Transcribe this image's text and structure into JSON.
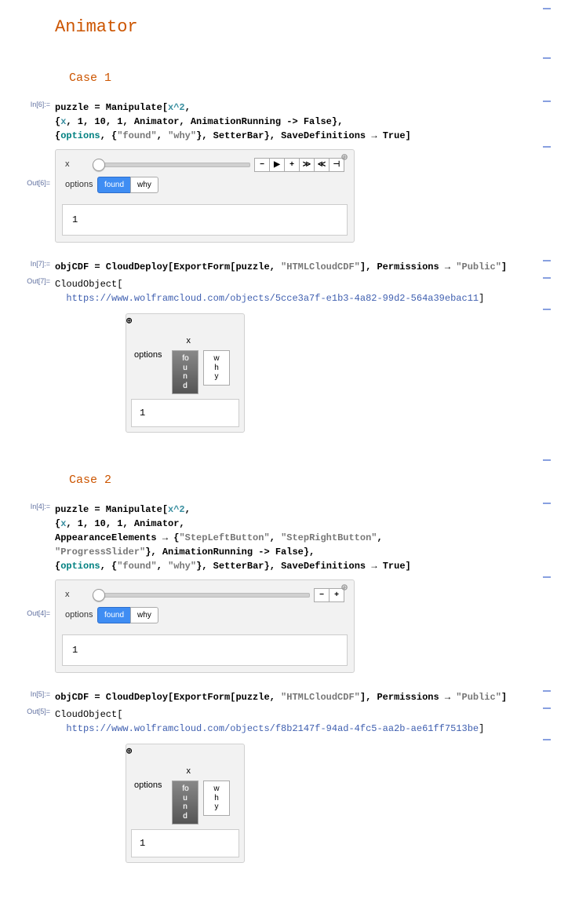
{
  "title": "Animator",
  "case1": {
    "title": "Case 1",
    "in6_label": "In[6]:=",
    "out6_label": "Out[6]=",
    "in7_label": "In[7]:=",
    "out7_label": "Out[7]=",
    "code_line1_a": "puzzle = Manipulate[",
    "code_line1_b": "x^2",
    "code_line1_c": ",",
    "code_line2_a": "  {",
    "code_line2_b": "x",
    "code_line2_c": ", 1, 10, 1, Animator, AnimationRunning -> False},",
    "code_line3_a": "  {",
    "code_line3_b": "options",
    "code_line3_c": ", {",
    "code_line3_d": "\"found\"",
    "code_line3_e": ", ",
    "code_line3_f": "\"why\"",
    "code_line3_g": "}, SetterBar}, SaveDefinitions → True]",
    "x_label": "x",
    "options_label": "options",
    "opt_found": "found",
    "opt_why": "why",
    "output_value": "1",
    "anim_buttons": [
      "−",
      "▶",
      "+",
      "≫",
      "≪",
      "⊣"
    ],
    "deploy_code_a": "objCDF = CloudDeploy[ExportForm[puzzle, ",
    "deploy_code_b": "\"HTMLCloudCDF\"",
    "deploy_code_c": "], Permissions → ",
    "deploy_code_d": "\"Public\"",
    "deploy_code_e": "]",
    "cloudobj_a": "CloudObject[",
    "cloudobj_url": "https://www.wolframcloud.com/objects/5cce3a7f-e1b3-4a82-99d2-564a39ebac11",
    "cloudobj_c": "]",
    "narrow_x": "x",
    "narrow_optlabel": "options",
    "narrow_found": "found",
    "narrow_why": "why",
    "narrow_output": "1"
  },
  "case2": {
    "title": "Case 2",
    "in4_label": "In[4]:=",
    "out4_label": "Out[4]=",
    "in5_label": "In[5]:=",
    "out5_label": "Out[5]=",
    "code_line1_a": "puzzle = Manipulate[",
    "code_line1_b": "x^2",
    "code_line1_c": ",",
    "code_line2_a": "  {",
    "code_line2_b": "x",
    "code_line2_c": ", 1, 10, 1, Animator,",
    "code_line3_a": "    AppearanceElements → {",
    "code_line3_b": "\"StepLeftButton\"",
    "code_line3_c": ", ",
    "code_line3_d": "\"StepRightButton\"",
    "code_line3_e": ",",
    "code_line4_a": "      ",
    "code_line4_b": "\"ProgressSlider\"",
    "code_line4_c": "}, AnimationRunning -> False},",
    "code_line5_a": "  {",
    "code_line5_b": "options",
    "code_line5_c": ", {",
    "code_line5_d": "\"found\"",
    "code_line5_e": ", ",
    "code_line5_f": "\"why\"",
    "code_line5_g": "}, SetterBar}, SaveDefinitions → True]",
    "x_label": "x",
    "options_label": "options",
    "opt_found": "found",
    "opt_why": "why",
    "output_value": "1",
    "step_buttons": [
      "−",
      "+"
    ],
    "deploy_code_a": "objCDF = CloudDeploy[ExportForm[puzzle, ",
    "deploy_code_b": "\"HTMLCloudCDF\"",
    "deploy_code_c": "], Permissions → ",
    "deploy_code_d": "\"Public\"",
    "deploy_code_e": "]",
    "cloudobj_a": "CloudObject[",
    "cloudobj_url": "https://www.wolframcloud.com/objects/f8b2147f-94ad-4fc5-aa2b-ae61ff7513be",
    "cloudobj_c": "]",
    "narrow_x": "x",
    "narrow_optlabel": "options",
    "narrow_found": "found",
    "narrow_why": "why",
    "narrow_output": "1"
  }
}
